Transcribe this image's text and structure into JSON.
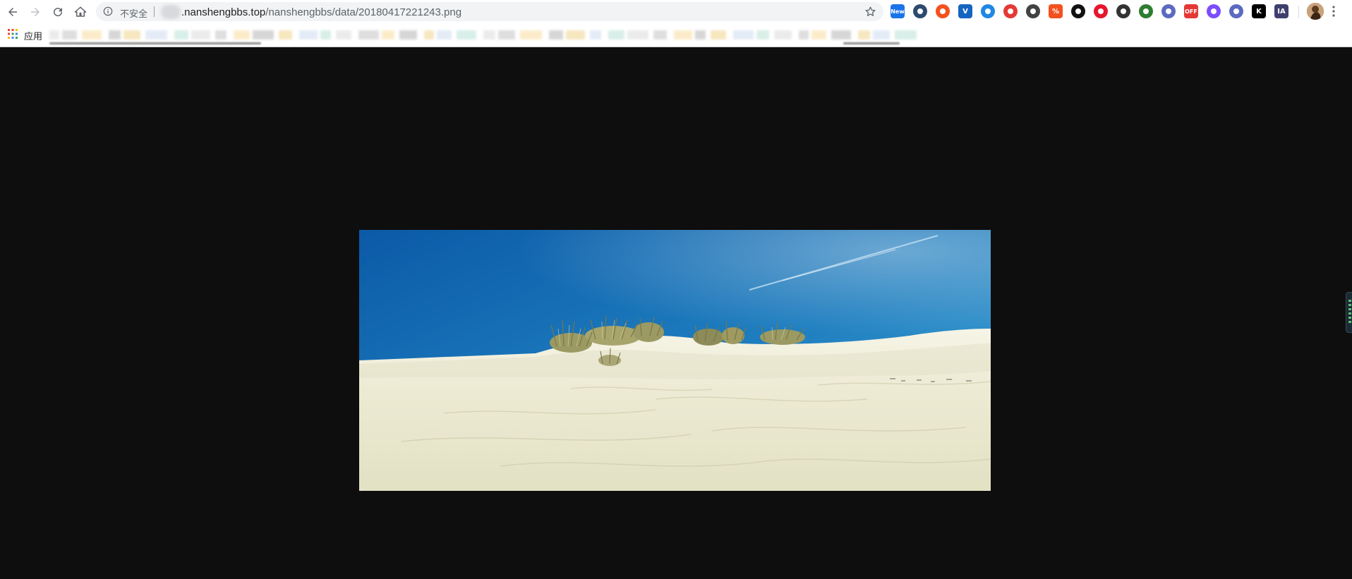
{
  "browser": {
    "security_label": "不安全",
    "url_host": ".nanshengbbs.top",
    "url_path": "/nanshengbbs/data/20180417221243.png"
  },
  "bookmarks": {
    "apps_label": "应用"
  },
  "extensions": [
    {
      "name": "new-badge-extension",
      "label": "New",
      "color": "#1a73e8"
    },
    {
      "name": "extension-2",
      "color": "#2d4a6e"
    },
    {
      "name": "extension-3",
      "color": "#f4511e"
    },
    {
      "name": "extension-4",
      "label": "V",
      "color": "#1565c0"
    },
    {
      "name": "extension-5",
      "color": "#1e88e5"
    },
    {
      "name": "extension-6",
      "color": "#e53935"
    },
    {
      "name": "extension-7",
      "color": "#424242"
    },
    {
      "name": "extension-8",
      "label": "%",
      "color": "#f4511e"
    },
    {
      "name": "extension-9",
      "color": "#111111"
    },
    {
      "name": "weibo-extension",
      "color": "#e6162d"
    },
    {
      "name": "extension-11",
      "color": "#333333"
    },
    {
      "name": "extension-12",
      "color": "#2e7d32"
    },
    {
      "name": "extension-13",
      "color": "#5c6bc0"
    },
    {
      "name": "off-badge-extension",
      "label": "OFF",
      "color": "#e53935"
    },
    {
      "name": "extension-15",
      "color": "#7c4dff"
    },
    {
      "name": "extension-16",
      "color": "#5c6bc0"
    },
    {
      "name": "extension-17",
      "label": "K",
      "color": "#000000"
    },
    {
      "name": "extension-18",
      "label": "IA",
      "color": "#3f3f6e"
    }
  ],
  "image": {
    "subject": "sand-dune-with-grass-under-blue-sky"
  },
  "colors": {
    "viewer_background": "#0e0e0e",
    "sky_top": "#0b5aa7",
    "sky_horizon": "#3ea3d6",
    "sand": "#efeed8"
  }
}
